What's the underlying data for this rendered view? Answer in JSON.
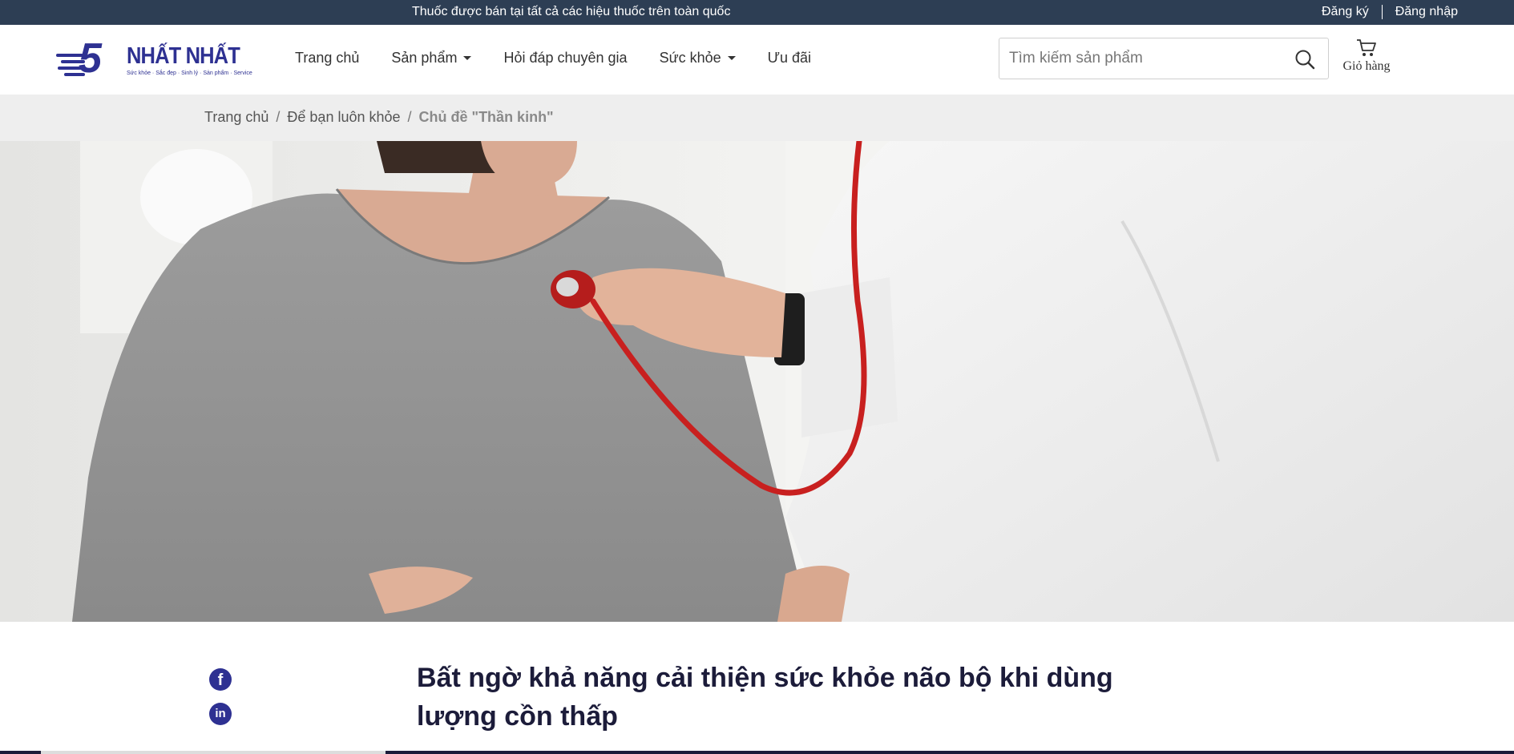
{
  "topbar": {
    "notice": "Thuốc được bán tại tất cả các hiệu thuốc trên toàn quốc",
    "register": "Đăng ký",
    "login": "Đăng nhập"
  },
  "logo": {
    "brand": "NHẤT NHẤT",
    "tagline": "Sức khỏe · Sắc đẹp · Sinh lý · Sản phẩm · Service"
  },
  "nav": {
    "home": "Trang chủ",
    "products": "Sản phẩm",
    "expert_qa": "Hỏi đáp chuyên gia",
    "health": "Sức khỏe",
    "offers": "Ưu đãi"
  },
  "search": {
    "placeholder": "Tìm kiếm sản phẩm"
  },
  "cart": {
    "label": "Giỏ hàng"
  },
  "breadcrumb": {
    "home": "Trang chủ",
    "section": "Để bạn luôn khỏe",
    "current": "Chủ đề \"Thần kinh\""
  },
  "article": {
    "title": "Bất ngờ khả năng cải thiện sức khỏe não bộ khi dùng lượng cồn thấp",
    "share_facebook": "f",
    "share_linkedin": "in"
  },
  "colors": {
    "topbar_bg": "#2d3e54",
    "brand": "#2e3192",
    "breadcrumb_bg": "#eeeeee",
    "title": "#1c1c3a"
  }
}
